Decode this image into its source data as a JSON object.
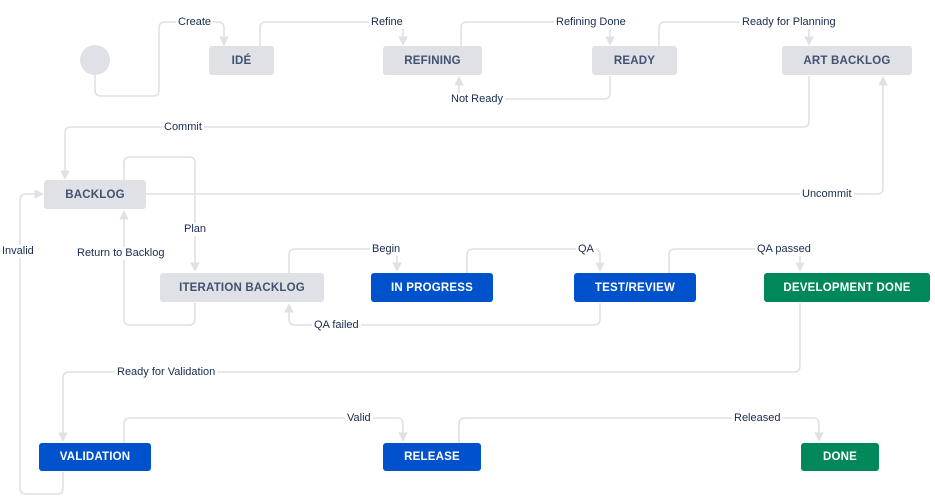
{
  "statuses": {
    "ide": "IDÉ",
    "refining": "REFINING",
    "ready": "READY",
    "art_backlog": "ART BACKLOG",
    "backlog": "BACKLOG",
    "iteration_backlog": "ITERATION BACKLOG",
    "in_progress": "IN PROGRESS",
    "test_review": "TEST/REVIEW",
    "development_done": "DEVELOPMENT DONE",
    "validation": "VALIDATION",
    "release": "RELEASE",
    "done": "DONE"
  },
  "transitions": {
    "create": "Create",
    "refine": "Refine",
    "refining_done": "Refining Done",
    "ready_for_planning": "Ready for Planning",
    "not_ready": "Not Ready",
    "commit": "Commit",
    "uncommit": "Uncommit",
    "plan": "Plan",
    "invalid": "Invalid",
    "return_to_backlog": "Return to Backlog",
    "begin": "Begin",
    "qa": "QA",
    "qa_passed": "QA passed",
    "qa_failed": "QA failed",
    "ready_for_validation": "Ready for Validation",
    "valid": "Valid",
    "released": "Released"
  },
  "colors": {
    "todo": "#dfe1e6",
    "in_progress": "#0052cc",
    "done": "#00875a",
    "connector": "#dfe1e6"
  }
}
